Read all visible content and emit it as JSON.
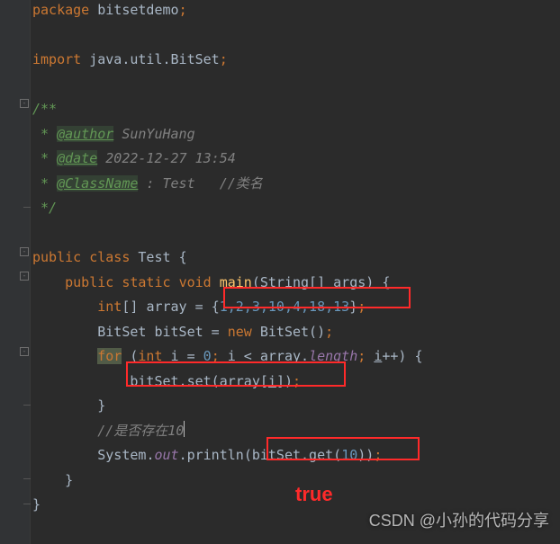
{
  "code": {
    "package_kw": "package",
    "package_name": "bitsetdemo",
    "semi": ";",
    "import_kw": "import",
    "import_path": "java.util.BitSet",
    "doc_open": "/**",
    "doc_star": " * ",
    "doc_author_tag": "@author",
    "doc_author_val": " SunYuHang",
    "doc_date_tag": "@date",
    "doc_date_val": " 2022-12-27 13:54",
    "doc_class_tag": "@ClassName",
    "doc_class_sep": " : ",
    "doc_class_val": "Test",
    "doc_class_comment": "   //类名",
    "doc_close": " */",
    "public_kw": "public",
    "class_kw": "class",
    "class_name": "Test",
    "lbrace": "{",
    "rbrace": "}",
    "static_kw": "static",
    "void_kw": "void",
    "main_fn": "main",
    "main_params": "(String[] args) ",
    "int_kw": "int",
    "brackets": "[]",
    "array_var": "array",
    "eq": " = ",
    "arr_open": "{",
    "arr_vals": "1,2,3,10,4,18,13",
    "arr_close": "}",
    "bitset_type": "BitSet",
    "bitset_var": "bitSet",
    "new_kw": "new",
    "bitset_ctor": "BitSet()",
    "for_kw": "for",
    "for_open": " (",
    "i_var": "i",
    "zero": "0",
    "lt": " < ",
    "length_prop": "length",
    "inc": "++",
    "for_close": ") ",
    "set_call_pre": "bitSet.set(array[",
    "set_call_post": "])",
    "comment_exists": "//是否存在10",
    "system": "System",
    "dot": ".",
    "out": "out",
    "println": "println",
    "get_call": "(bitSet.get(",
    "ten": "10",
    "get_close": "))"
  },
  "annotations": {
    "result_text": "true",
    "watermark": "CSDN @小孙的代码分享"
  },
  "chart_data": {
    "type": "table",
    "title": "Java BitSet demo code",
    "array_values": [
      1,
      2,
      3,
      10,
      4,
      18,
      13
    ],
    "check_value": 10,
    "expected_output": "true"
  }
}
